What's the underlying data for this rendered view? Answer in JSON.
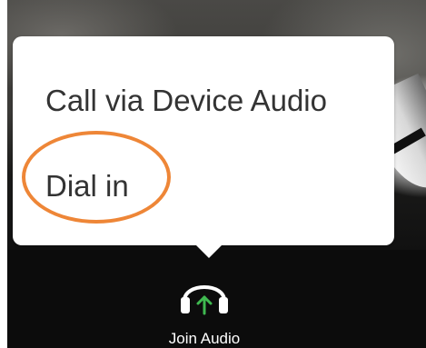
{
  "audio_menu": {
    "items": [
      {
        "label": "Call via Device Audio"
      },
      {
        "label": "Dial in"
      }
    ]
  },
  "toolbar": {
    "join_audio": {
      "label": "Join Audio",
      "icon": "headphones-icon",
      "arrow_color": "#3fb950"
    }
  },
  "annotation": {
    "highlight_color": "#ee8637"
  },
  "colors": {
    "toolbar_bg": "#0c0c0c",
    "menu_bg": "#ffffff",
    "menu_text": "#333333"
  }
}
